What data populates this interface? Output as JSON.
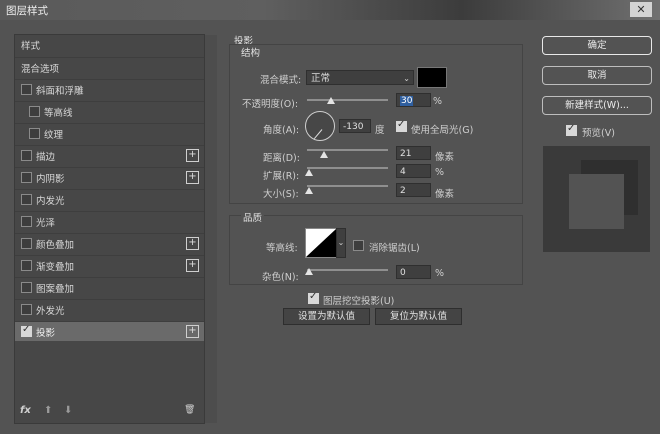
{
  "window": {
    "title": "图层样式",
    "close_label": "✕"
  },
  "left_panel": {
    "items": [
      {
        "label": "样式"
      },
      {
        "label": "混合选项"
      },
      {
        "label": "斜面和浮雕"
      },
      {
        "label": "等高线"
      },
      {
        "label": "纹理"
      },
      {
        "label": "描边"
      },
      {
        "label": "内阴影"
      },
      {
        "label": "内发光"
      },
      {
        "label": "光泽"
      },
      {
        "label": "颜色叠加"
      },
      {
        "label": "渐变叠加"
      },
      {
        "label": "图案叠加"
      },
      {
        "label": "外发光"
      },
      {
        "label": "投影"
      }
    ],
    "plus_label": "+",
    "fx_label": "fx",
    "up_label": "⬆",
    "down_label": "⬇",
    "trash_label": "🗑"
  },
  "shadow": {
    "title": "投影",
    "structure": {
      "title": "结构",
      "blend_mode_label": "混合模式:",
      "blend_mode_value": "正常",
      "blend_color": "#000000",
      "opacity_label": "不透明度(O):",
      "opacity_value": "30",
      "percent": "%",
      "angle_label": "角度(A):",
      "angle_value": "-130",
      "degree_unit": "度",
      "global_light_label": "使用全局光(G)",
      "distance_label": "距离(D):",
      "distance_value": "21",
      "spread_label": "扩展(R):",
      "spread_value": "4",
      "size_label": "大小(S):",
      "size_value": "2",
      "px_unit": "像素"
    },
    "quality": {
      "title": "品质",
      "contour_label": "等高线:",
      "antialias_label": "消除锯齿(L)",
      "noise_label": "杂色(N):",
      "noise_value": "0",
      "percent": "%"
    },
    "layer_knockout_label": "图层挖空投影(U)",
    "set_default_label": "设置为默认值",
    "reset_default_label": "复位为默认值"
  },
  "right_panel": {
    "ok_label": "确定",
    "cancel_label": "取消",
    "new_style_label": "新建样式(W)...",
    "preview_label": "预览(V)"
  }
}
